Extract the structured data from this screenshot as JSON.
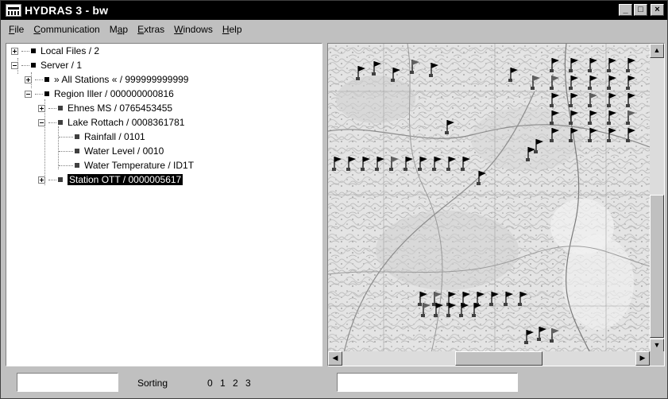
{
  "window": {
    "title": "HYDRAS 3 - bw",
    "controls": {
      "minimize": "_",
      "maximize": "□",
      "close": "×"
    }
  },
  "menu": [
    {
      "label": "File",
      "u": "F",
      "rest": "ile"
    },
    {
      "label": "Communication",
      "u": "C",
      "rest": "ommunication"
    },
    {
      "label": "Map",
      "pre": "M",
      "u": "a",
      "rest": "p"
    },
    {
      "label": "Extras",
      "u": "E",
      "rest": "xtras"
    },
    {
      "label": "Windows",
      "u": "W",
      "rest": "indows"
    },
    {
      "label": "Help",
      "u": "H",
      "rest": "elp"
    }
  ],
  "tree": {
    "local_files": "Local Files / 2",
    "server": "Server / 1",
    "all_stations": "» All Stations « / 999999999999",
    "region_iller": "Region Iller / 000000000816",
    "ehnes_ms": "Ehnes MS / 0765453455",
    "lake_rottach": "Lake Rottach / 0008361781",
    "rainfall": "Rainfall / 0101",
    "water_level": "Water Level / 0010",
    "water_temperature": "Water Temperature / ID1T",
    "station_ott": "Station OTT / 0000005617"
  },
  "status": {
    "sorting_label": "Sorting",
    "sort_options": [
      "0",
      "1",
      "2",
      "3"
    ],
    "left_input_value": "",
    "right_input_value": ""
  },
  "icons": {
    "app": "ott-logo-icon",
    "station": "flag-icon"
  }
}
